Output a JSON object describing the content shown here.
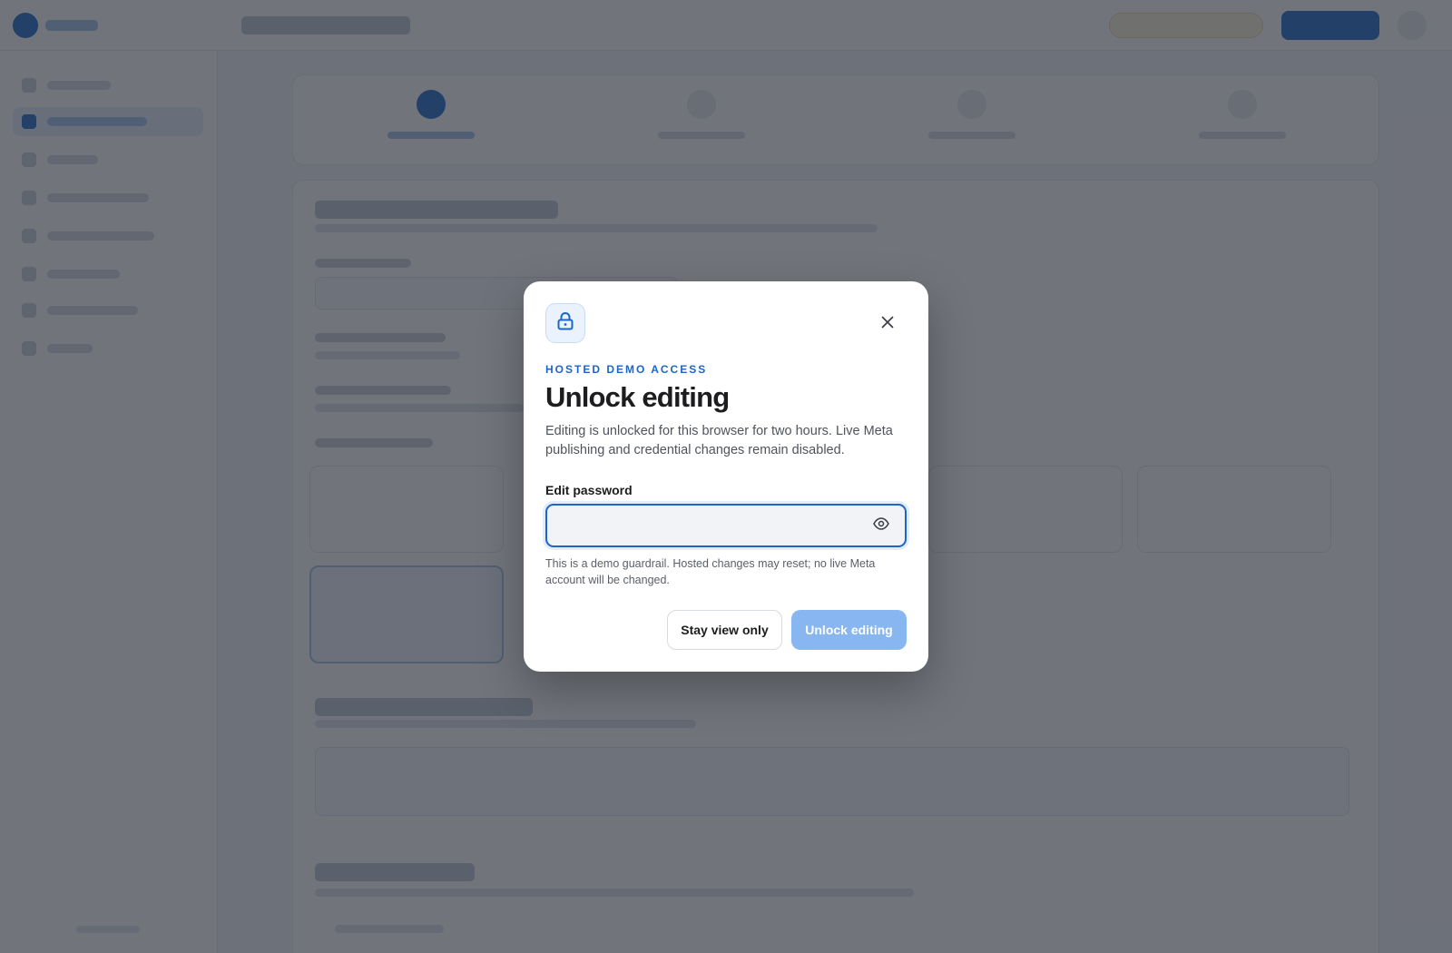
{
  "colors": {
    "accent": "#1b66c9",
    "disabled_primary": "#87b6f0",
    "overlay": "rgba(40,44,54,0.66)"
  },
  "modal": {
    "lock_icon": "lock-icon",
    "close_icon": "close-icon",
    "eyebrow": "HOSTED DEMO ACCESS",
    "title": "Unlock editing",
    "description": "Editing is unlocked for this browser for two hours. Live Meta publishing and credential changes remain disabled.",
    "password": {
      "label": "Edit password",
      "value": "",
      "reveal_icon": "eye-icon"
    },
    "hint": "This is a demo guardrail. Hosted changes may reset; no live Meta account will be changed.",
    "secondary_button": "Stay view only",
    "primary_button": "Unlock editing",
    "primary_disabled": true
  }
}
